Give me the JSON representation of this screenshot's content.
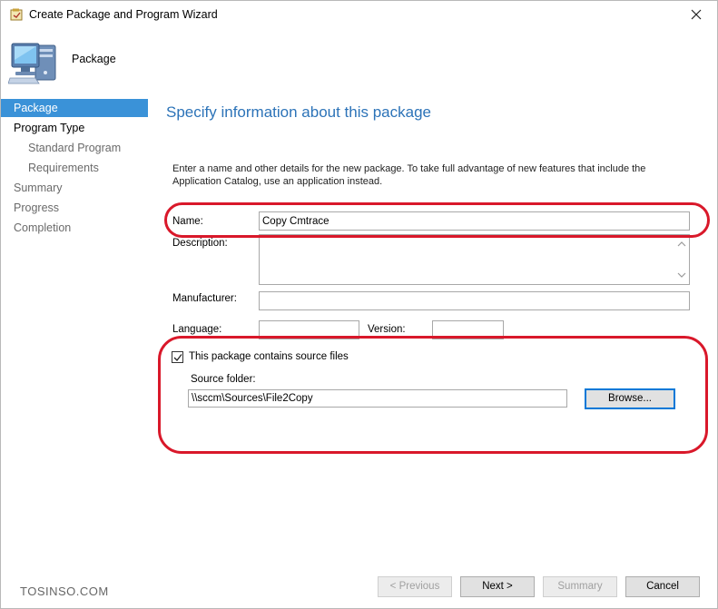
{
  "window": {
    "title": "Create Package and Program Wizard"
  },
  "header": {
    "title": "Package",
    "icon": "computer-icon"
  },
  "nav": {
    "items": [
      {
        "label": "Package",
        "state": "active"
      },
      {
        "label": "Program Type",
        "state": "current"
      },
      {
        "label": "Standard Program",
        "state": "sub"
      },
      {
        "label": "Requirements",
        "state": "sub"
      },
      {
        "label": "Summary",
        "state": "normal"
      },
      {
        "label": "Progress",
        "state": "normal"
      },
      {
        "label": "Completion",
        "state": "normal"
      }
    ]
  },
  "main": {
    "heading": "Specify information about this package",
    "intro": "Enter a name and other details for the new package. To take full advantage of new features that include the Application Catalog, use an application instead.",
    "name_label": "Name:",
    "name_value": "Copy Cmtrace",
    "description_label": "Description:",
    "description_value": "",
    "manufacturer_label": "Manufacturer:",
    "manufacturer_value": "",
    "language_label": "Language:",
    "language_value": "",
    "version_label": "Version:",
    "version_value": "",
    "source_checkbox_label": "This package contains source files",
    "source_checkbox_checked": true,
    "source_folder_label": "Source folder:",
    "source_folder_value": "\\\\sccm\\Sources\\File2Copy",
    "browse_label": "Browse..."
  },
  "footer": {
    "previous_label": "< Previous",
    "next_label": "Next >",
    "summary_label": "Summary",
    "cancel_label": "Cancel",
    "watermark": "TOSINSO.COM"
  },
  "colors": {
    "accent": "#2c73b8",
    "nav_active": "#3a92d8",
    "annotation": "#d9182a"
  }
}
